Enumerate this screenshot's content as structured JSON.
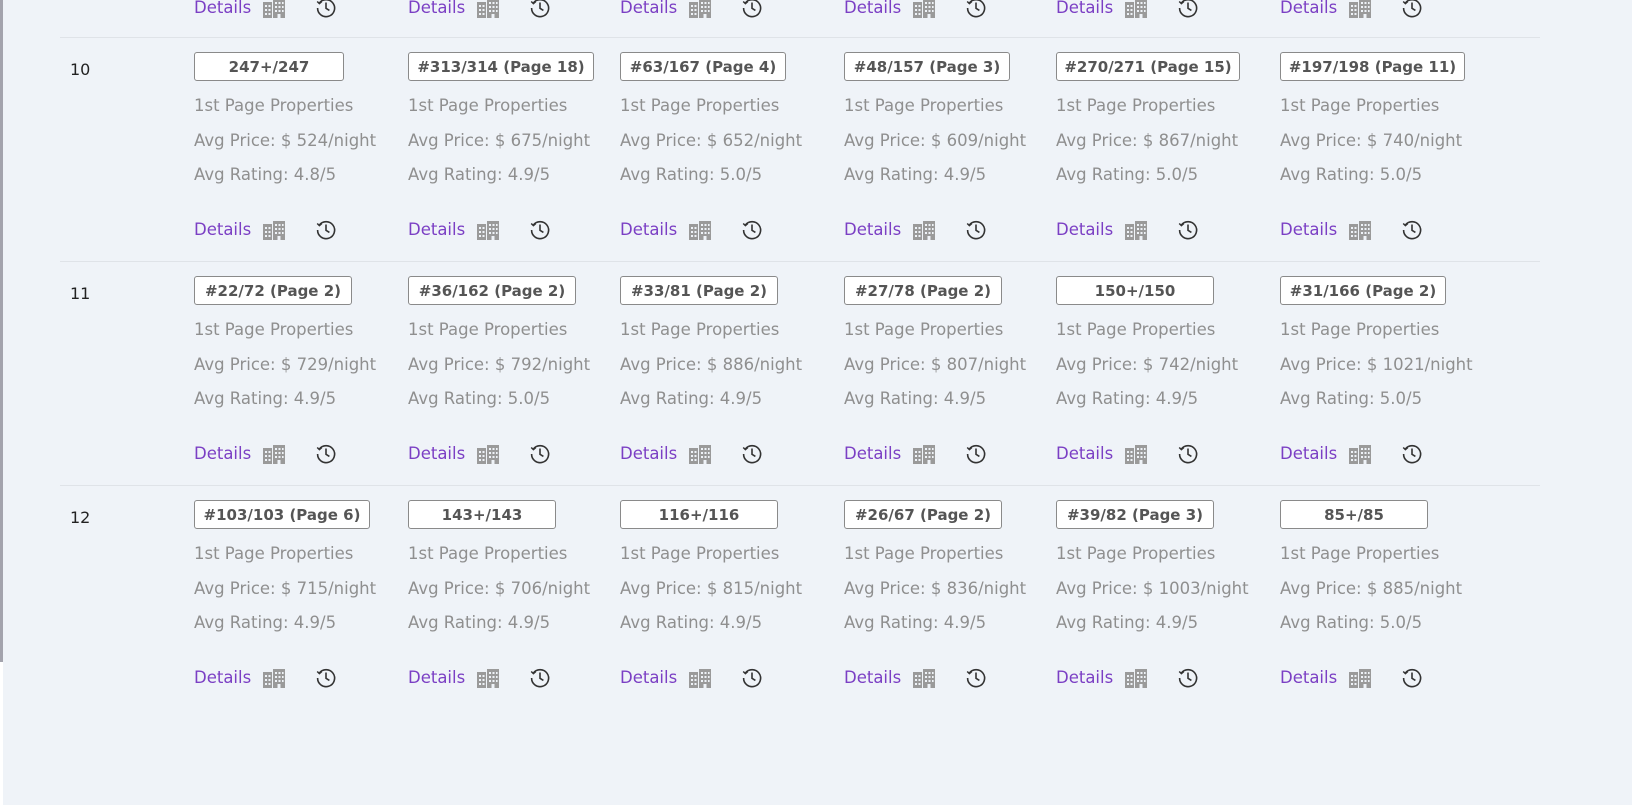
{
  "details_label": "Details",
  "first_page_label": "1st Page Properties",
  "avg_price_prefix": "Avg Price: $ ",
  "avg_price_suffix": "/night",
  "avg_rating_prefix": "Avg Rating: ",
  "avg_rating_suffix": "/5",
  "icons": {
    "building": "building-icon",
    "history": "history-clock-icon"
  },
  "colors": {
    "link": "#7b3fc4",
    "muted_text": "#8f8f8f",
    "background": "#eff3f8"
  },
  "rows": [
    {
      "number": "10",
      "cells": [
        {
          "rank": "247+/247",
          "price": "524",
          "rating": "4.8"
        },
        {
          "rank": "#313/314 (Page 18)",
          "price": "675",
          "rating": "4.9"
        },
        {
          "rank": "#63/167 (Page 4)",
          "price": "652",
          "rating": "5.0"
        },
        {
          "rank": "#48/157 (Page 3)",
          "price": "609",
          "rating": "4.9"
        },
        {
          "rank": "#270/271 (Page 15)",
          "price": "867",
          "rating": "5.0"
        },
        {
          "rank": "#197/198 (Page 11)",
          "price": "740",
          "rating": "5.0"
        }
      ]
    },
    {
      "number": "11",
      "cells": [
        {
          "rank": "#22/72 (Page 2)",
          "price": "729",
          "rating": "4.9"
        },
        {
          "rank": "#36/162 (Page 2)",
          "price": "792",
          "rating": "5.0"
        },
        {
          "rank": "#33/81 (Page 2)",
          "price": "886",
          "rating": "4.9"
        },
        {
          "rank": "#27/78 (Page 2)",
          "price": "807",
          "rating": "4.9"
        },
        {
          "rank": "150+/150",
          "price": "742",
          "rating": "4.9"
        },
        {
          "rank": "#31/166 (Page 2)",
          "price": "1021",
          "rating": "5.0"
        }
      ]
    },
    {
      "number": "12",
      "cells": [
        {
          "rank": "#103/103 (Page 6)",
          "price": "715",
          "rating": "4.9"
        },
        {
          "rank": "143+/143",
          "price": "706",
          "rating": "4.9"
        },
        {
          "rank": "116+/116",
          "price": "815",
          "rating": "4.9"
        },
        {
          "rank": "#26/67 (Page 2)",
          "price": "836",
          "rating": "4.9"
        },
        {
          "rank": "#39/82 (Page 3)",
          "price": "1003",
          "rating": "4.9"
        },
        {
          "rank": "85+/85",
          "price": "885",
          "rating": "5.0"
        }
      ]
    }
  ]
}
